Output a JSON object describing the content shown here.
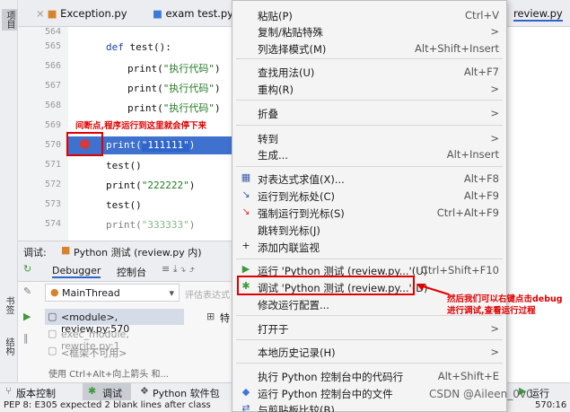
{
  "sidebar_left": {
    "project": "项目",
    "bookmarks": "书签",
    "structure": "结构"
  },
  "tabs": [
    {
      "label": "Exception.py"
    },
    {
      "label": "exam test.py"
    },
    {
      "label": "review.py"
    }
  ],
  "editor": {
    "line_numbers": [
      "564",
      "565",
      "566",
      "567",
      "568",
      "569",
      "570",
      "571",
      "572",
      "573",
      "574"
    ],
    "lines": [
      {
        "pre": "def ",
        "kw": "",
        "text": "test():",
        "str": ""
      },
      {
        "pre": "print(",
        "str": "\"执行代码\"",
        "post": ")"
      },
      {
        "pre": "print(",
        "str": "\"执行代码\"",
        "post": ")"
      },
      {
        "pre": "print(",
        "str": "\"执行代码\"",
        "post": ")"
      },
      {
        "pre": "print(",
        "str": "\"111111\"",
        "post": ")"
      },
      {
        "pre": "test()",
        "str": "",
        "post": ""
      },
      {
        "pre": "print(",
        "str": "\"222222\"",
        "post": ")"
      },
      {
        "pre": "test()",
        "str": "",
        "post": ""
      },
      {
        "pre": "print(",
        "str": "\"333333\"",
        "post": ")"
      }
    ]
  },
  "annotations": {
    "breakpoint": "间断点,程序运行到这里就会停下来",
    "debug_line1": "然后我们可以右键点击debug",
    "debug_line2": "进行调试,查看运行过程",
    "watermark": "CSDN @Aileen_0v0"
  },
  "debug_panel": {
    "title": "调试:",
    "config": "Python 测试 (review.py 内)",
    "tab_debugger": "Debugger",
    "tab_console": "控制台",
    "thread": "MainThread",
    "eval_hint": "评估表达式",
    "frames": [
      "<module>, review.py:570",
      "exec_module, rewrite.py:1",
      "<框架不可用>"
    ],
    "var_label": "特",
    "hint": "使用 Ctrl+Alt+向上箭头 和..."
  },
  "bottom_bar": {
    "vcs": "版本控制",
    "debug": "调试",
    "python_packages": "Python 软件包",
    "run": "运行"
  },
  "status": {
    "text": "PEP 8: E305 expected 2 blank lines after class",
    "pos": "570:16"
  },
  "context_menu": {
    "items": [
      {
        "label": "粘贴(P)",
        "shortcut": "Ctrl+V",
        "icon": ""
      },
      {
        "label": "复制/粘贴特殊",
        "shortcut": ">",
        "icon": ""
      },
      {
        "label": "列选择模式(M)",
        "shortcut": "Alt+Shift+Insert",
        "icon": ""
      },
      {
        "label": "查找用法(U)",
        "shortcut": "Alt+F7",
        "icon": ""
      },
      {
        "label": "重构(R)",
        "shortcut": ">",
        "icon": ""
      },
      {
        "label": "折叠",
        "shortcut": ">",
        "icon": ""
      },
      {
        "label": "转到",
        "shortcut": ">",
        "icon": ""
      },
      {
        "label": "生成...",
        "shortcut": "Alt+Insert",
        "icon": ""
      },
      {
        "label": "对表达式求值(X)...",
        "shortcut": "Alt+F8",
        "icon": "calc-icon"
      },
      {
        "label": "运行到光标处(C)",
        "shortcut": "Alt+F9",
        "icon": "run-to-cursor-icon"
      },
      {
        "label": "强制运行到光标(S)",
        "shortcut": "Ctrl+Alt+F9",
        "icon": "force-run-icon"
      },
      {
        "label": "跳转到光标(J)",
        "shortcut": "",
        "icon": ""
      },
      {
        "label": "添加内联监视",
        "shortcut": "",
        "icon": "plus-icon"
      },
      {
        "label": "运行 'Python 测试 (review.py...'(U)",
        "shortcut": "Ctrl+Shift+F10",
        "icon": "run-icon"
      },
      {
        "label": "调试 'Python 测试 (review.py...'(D)",
        "shortcut": "",
        "icon": "debug-icon"
      },
      {
        "label": "修改运行配置...",
        "shortcut": "",
        "icon": ""
      },
      {
        "label": "打开于",
        "shortcut": ">",
        "icon": ""
      },
      {
        "label": "本地历史记录(H)",
        "shortcut": ">",
        "icon": ""
      },
      {
        "label": "执行 Python 控制台中的代码行",
        "shortcut": "Alt+Shift+E",
        "icon": ""
      },
      {
        "label": "运行 Python 控制台中的文件",
        "shortcut": "",
        "icon": "python-icon"
      },
      {
        "label": "与剪贴板比较(B)",
        "shortcut": "",
        "icon": "compare-icon"
      }
    ]
  },
  "colors": {
    "accent": "#2f65ca",
    "annotation": "#e00000",
    "run_green": "#3c9a3c"
  }
}
